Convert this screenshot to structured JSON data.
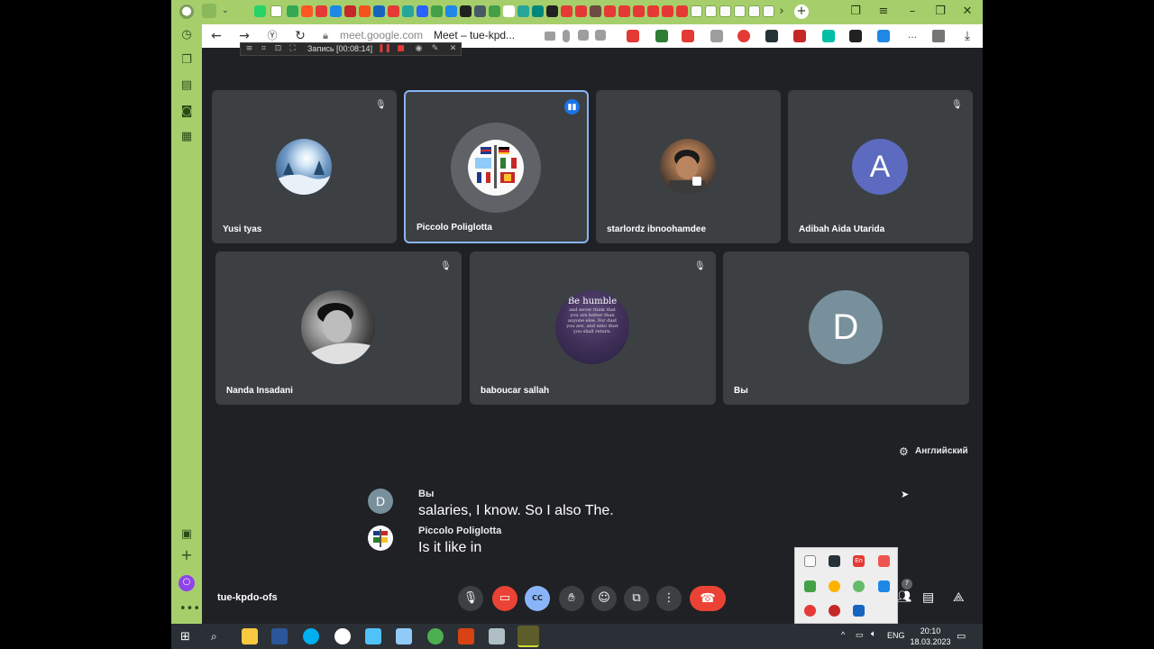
{
  "browser": {
    "url": "meet.google.com",
    "page_title": "Meet – tue-kpd..."
  },
  "recorder": {
    "label": "Запись [00:08:14]"
  },
  "participants_row1": [
    {
      "name": "Yusi tyas",
      "muted": true
    },
    {
      "name": "Piccolo Poliglotta",
      "muted": false,
      "speaking": true
    },
    {
      "name": "starlordz ibnoohamdee",
      "muted": false
    },
    {
      "name": "Adibah Aida Utarida",
      "muted": true,
      "initial": "A",
      "color": "#5c6bc0"
    }
  ],
  "participants_row2": [
    {
      "name": "Nanda Insadani",
      "muted": true
    },
    {
      "name": "baboucar sallah",
      "muted": true
    },
    {
      "name": "Вы",
      "muted": false,
      "initial": "D",
      "color": "#78909c"
    }
  ],
  "baboucar_avatar_text": {
    "headline": "Be humble",
    "body": "and never think that you are better than anyone else. For dust you are, and unto dust you shall return."
  },
  "caption_language": "Английский",
  "captions": [
    {
      "speaker": "Вы",
      "initial": "D",
      "text": "salaries, I know. So I also The."
    },
    {
      "speaker": "Piccolo Poliglotta",
      "text": "Is it like in"
    }
  ],
  "meeting_code": "tue-kpdo-ofs",
  "people_count": "7",
  "tray_ime": "En",
  "taskbar": {
    "language": "ENG",
    "time": "20:10",
    "date": "18.03.2023"
  },
  "colors": {
    "meet_bg": "#202124",
    "tile_bg": "#3c4043",
    "accent": "#8ab4f8",
    "end_call": "#ea4335",
    "browser_green": "#a6cf6c"
  }
}
